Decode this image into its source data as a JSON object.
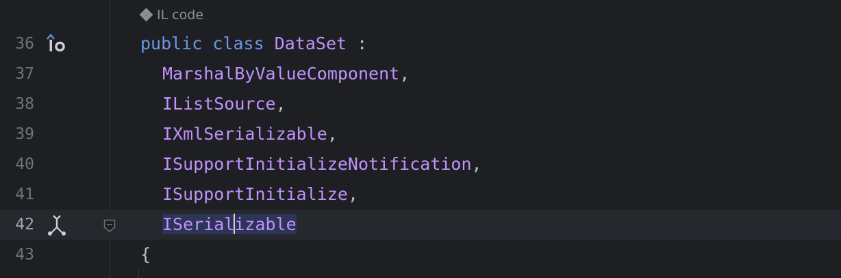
{
  "editor": {
    "inlay_hint": {
      "icon": "il-code-diamond-icon",
      "label": "IL code"
    },
    "lines": [
      {
        "number": "36",
        "gutter_icon": "implements-interface-icon",
        "keyword": "public class",
        "name": "DataSet",
        "suffix": " :"
      },
      {
        "number": "37",
        "name": "MarshalByValueComponent",
        "suffix": ","
      },
      {
        "number": "38",
        "name": "IListSource",
        "suffix": ","
      },
      {
        "number": "39",
        "name": "IXmlSerializable",
        "suffix": ","
      },
      {
        "number": "40",
        "name": "ISupportInitializeNotification",
        "suffix": ","
      },
      {
        "number": "41",
        "name": "ISupportInitialize",
        "suffix": ","
      },
      {
        "number": "42",
        "gutter_icon": "type-hierarchy-icon",
        "fold_icon": "fold-marker-icon",
        "name_before_caret": "ISerial",
        "name_after_caret": "izable",
        "current": true
      },
      {
        "number": "43",
        "text": "{"
      }
    ],
    "colors": {
      "background": "#1e1f22",
      "keyword": "#6c95eb",
      "type_name": "#c191ff",
      "punctuation": "#bcbec4",
      "line_number": "#6f737a",
      "current_line": "#26282e",
      "selection": "#2c3556"
    }
  }
}
